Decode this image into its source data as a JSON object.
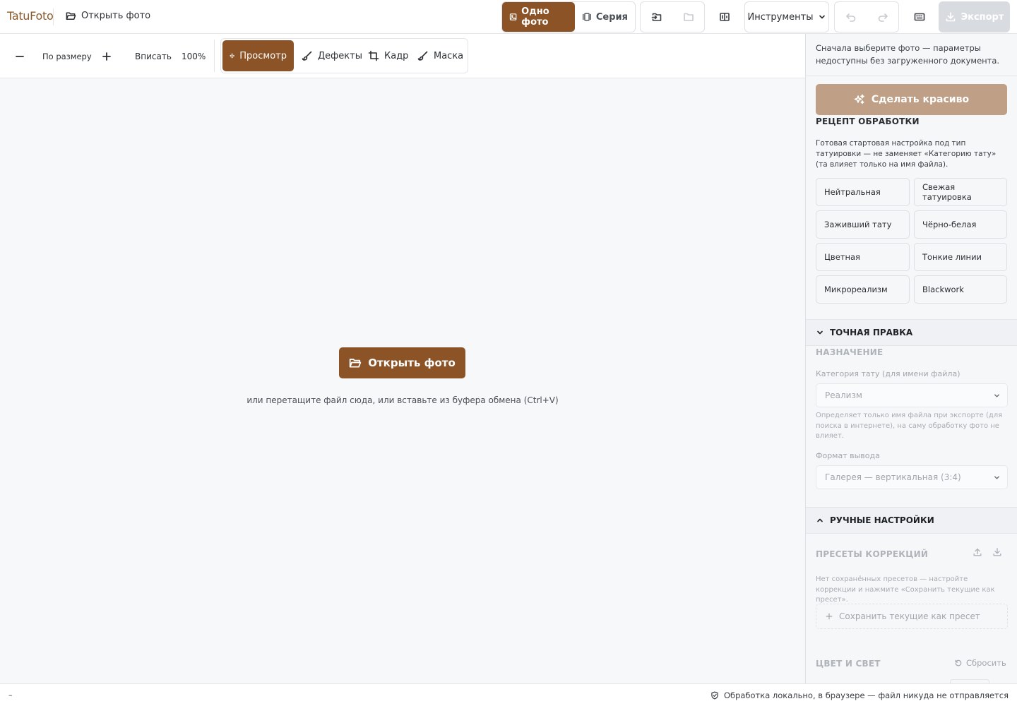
{
  "app": {
    "brand": "TatuFoto",
    "open_photo_link": "Открыть фото"
  },
  "topbar": {
    "modes": [
      {
        "label": "Одно фото",
        "active": true,
        "icon": "image-icon"
      },
      {
        "label": "Серия",
        "active": false,
        "icon": "gallery-icon"
      }
    ],
    "tools_dropdown": "Инструменты",
    "export_label": "Экспорт"
  },
  "toolbar": {
    "zoom_fit_label": "По размеру",
    "fit_label": "Вписать",
    "zoom_value": "100%",
    "tools": [
      {
        "label": "Просмотр",
        "active": true,
        "icon": "move-icon"
      },
      {
        "label": "Дефекты",
        "active": false,
        "icon": "brush-icon"
      },
      {
        "label": "Кадр",
        "active": false,
        "icon": "crop-icon"
      },
      {
        "label": "Маска",
        "active": false,
        "icon": "brush-icon"
      }
    ]
  },
  "canvas": {
    "open_button": "Открыть фото",
    "drop_hint": "или перетащите файл сюда, или вставьте из буфера обмена (Ctrl+V)"
  },
  "panel": {
    "notice": "Сначала выберите фото — параметры недоступны без загруженного документа.",
    "make_beautiful": "Сделать красиво",
    "recipe_title": "РЕЦЕПТ ОБРАБОТКИ",
    "recipe_desc": "Готовая стартовая настройка под тип татуировки — не заменяет «Категорию тату» (та влияет только на имя файла).",
    "recipes": [
      "Нейтральная",
      "Свежая татуировка",
      "Заживший тату",
      "Чёрно-белая",
      "Цветная",
      "Тонкие линии",
      "Микрореализм",
      "Blackwork"
    ],
    "fine_tune_title": "ТОЧНАЯ ПРАВКА",
    "purpose_title": "НАЗНАЧЕНИЕ",
    "category_label": "Категория тату (для имени файла)",
    "category_value": "Реализм",
    "category_note": "Определяет только имя файла при экспорте (для поиска в интернете), на саму обработку фото не влияет.",
    "format_label": "Формат вывода",
    "format_value": "Галерея — вертикальная (3:4)",
    "manual_title": "РУЧНЫЕ НАСТРОЙКИ",
    "presets_title": "ПРЕСЕТЫ КОРРЕКЦИЙ",
    "presets_note": "Нет сохранённых пресетов — настройте коррекции и нажмите «Сохранить текущие как пресет».",
    "save_preset": "Сохранить текущие как пресет",
    "color_light_title": "ЦВЕТ И СВЕТ",
    "reset_label": "Сбросить"
  },
  "statusbar": {
    "left": "–",
    "right": "Обработка локально, в браузере — файл никуда не отправляется"
  },
  "colors": {
    "accent": "#8b5326",
    "accent_muted": "#bf9f85",
    "export_disabled": "#d8dbe0"
  }
}
